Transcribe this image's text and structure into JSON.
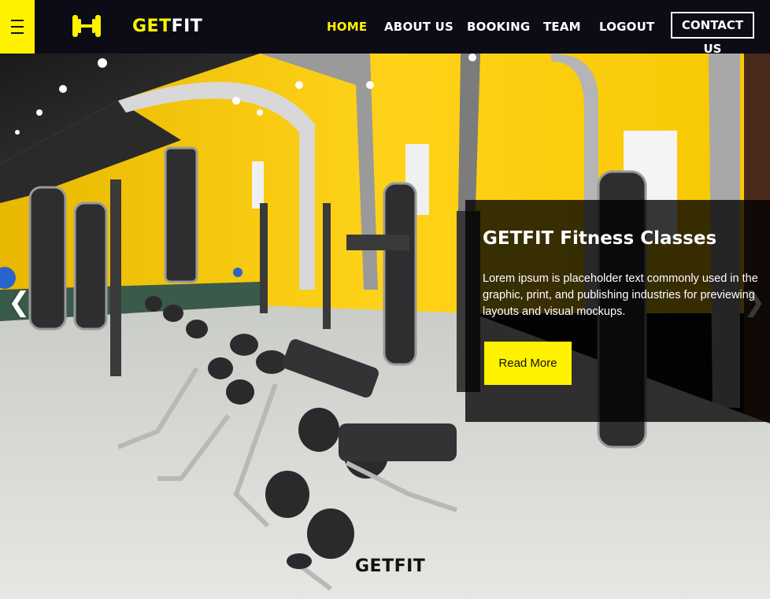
{
  "header": {
    "brand_get": "GET",
    "brand_fit": "FIT",
    "logo_icon": "dumbbell-icon",
    "menu_icon": "hamburger-menu-icon",
    "nav": {
      "home": "HOME",
      "about": "ABOUT US",
      "booking": "BOOKING",
      "team": "TEAM",
      "logout": "LOGOUT",
      "contact": "CONTACT US"
    },
    "active_item": "HOME"
  },
  "hero": {
    "background": "gym interior with yellow walls and exercise machines",
    "prev_arrow": "❮",
    "next_arrow": "❯",
    "caption": {
      "title": "GETFIT Fitness Classes",
      "text": "Lorem ipsum is placeholder text commonly used in the graphic, print, and publishing industries for previewing layouts and visual mockups.",
      "button": "Read More"
    },
    "footer_brand": "GETFIT"
  },
  "colors": {
    "accent": "#fff200",
    "header_bg": "#0c0c17",
    "caption_bg": "rgba(0,0,0,0.78)"
  }
}
